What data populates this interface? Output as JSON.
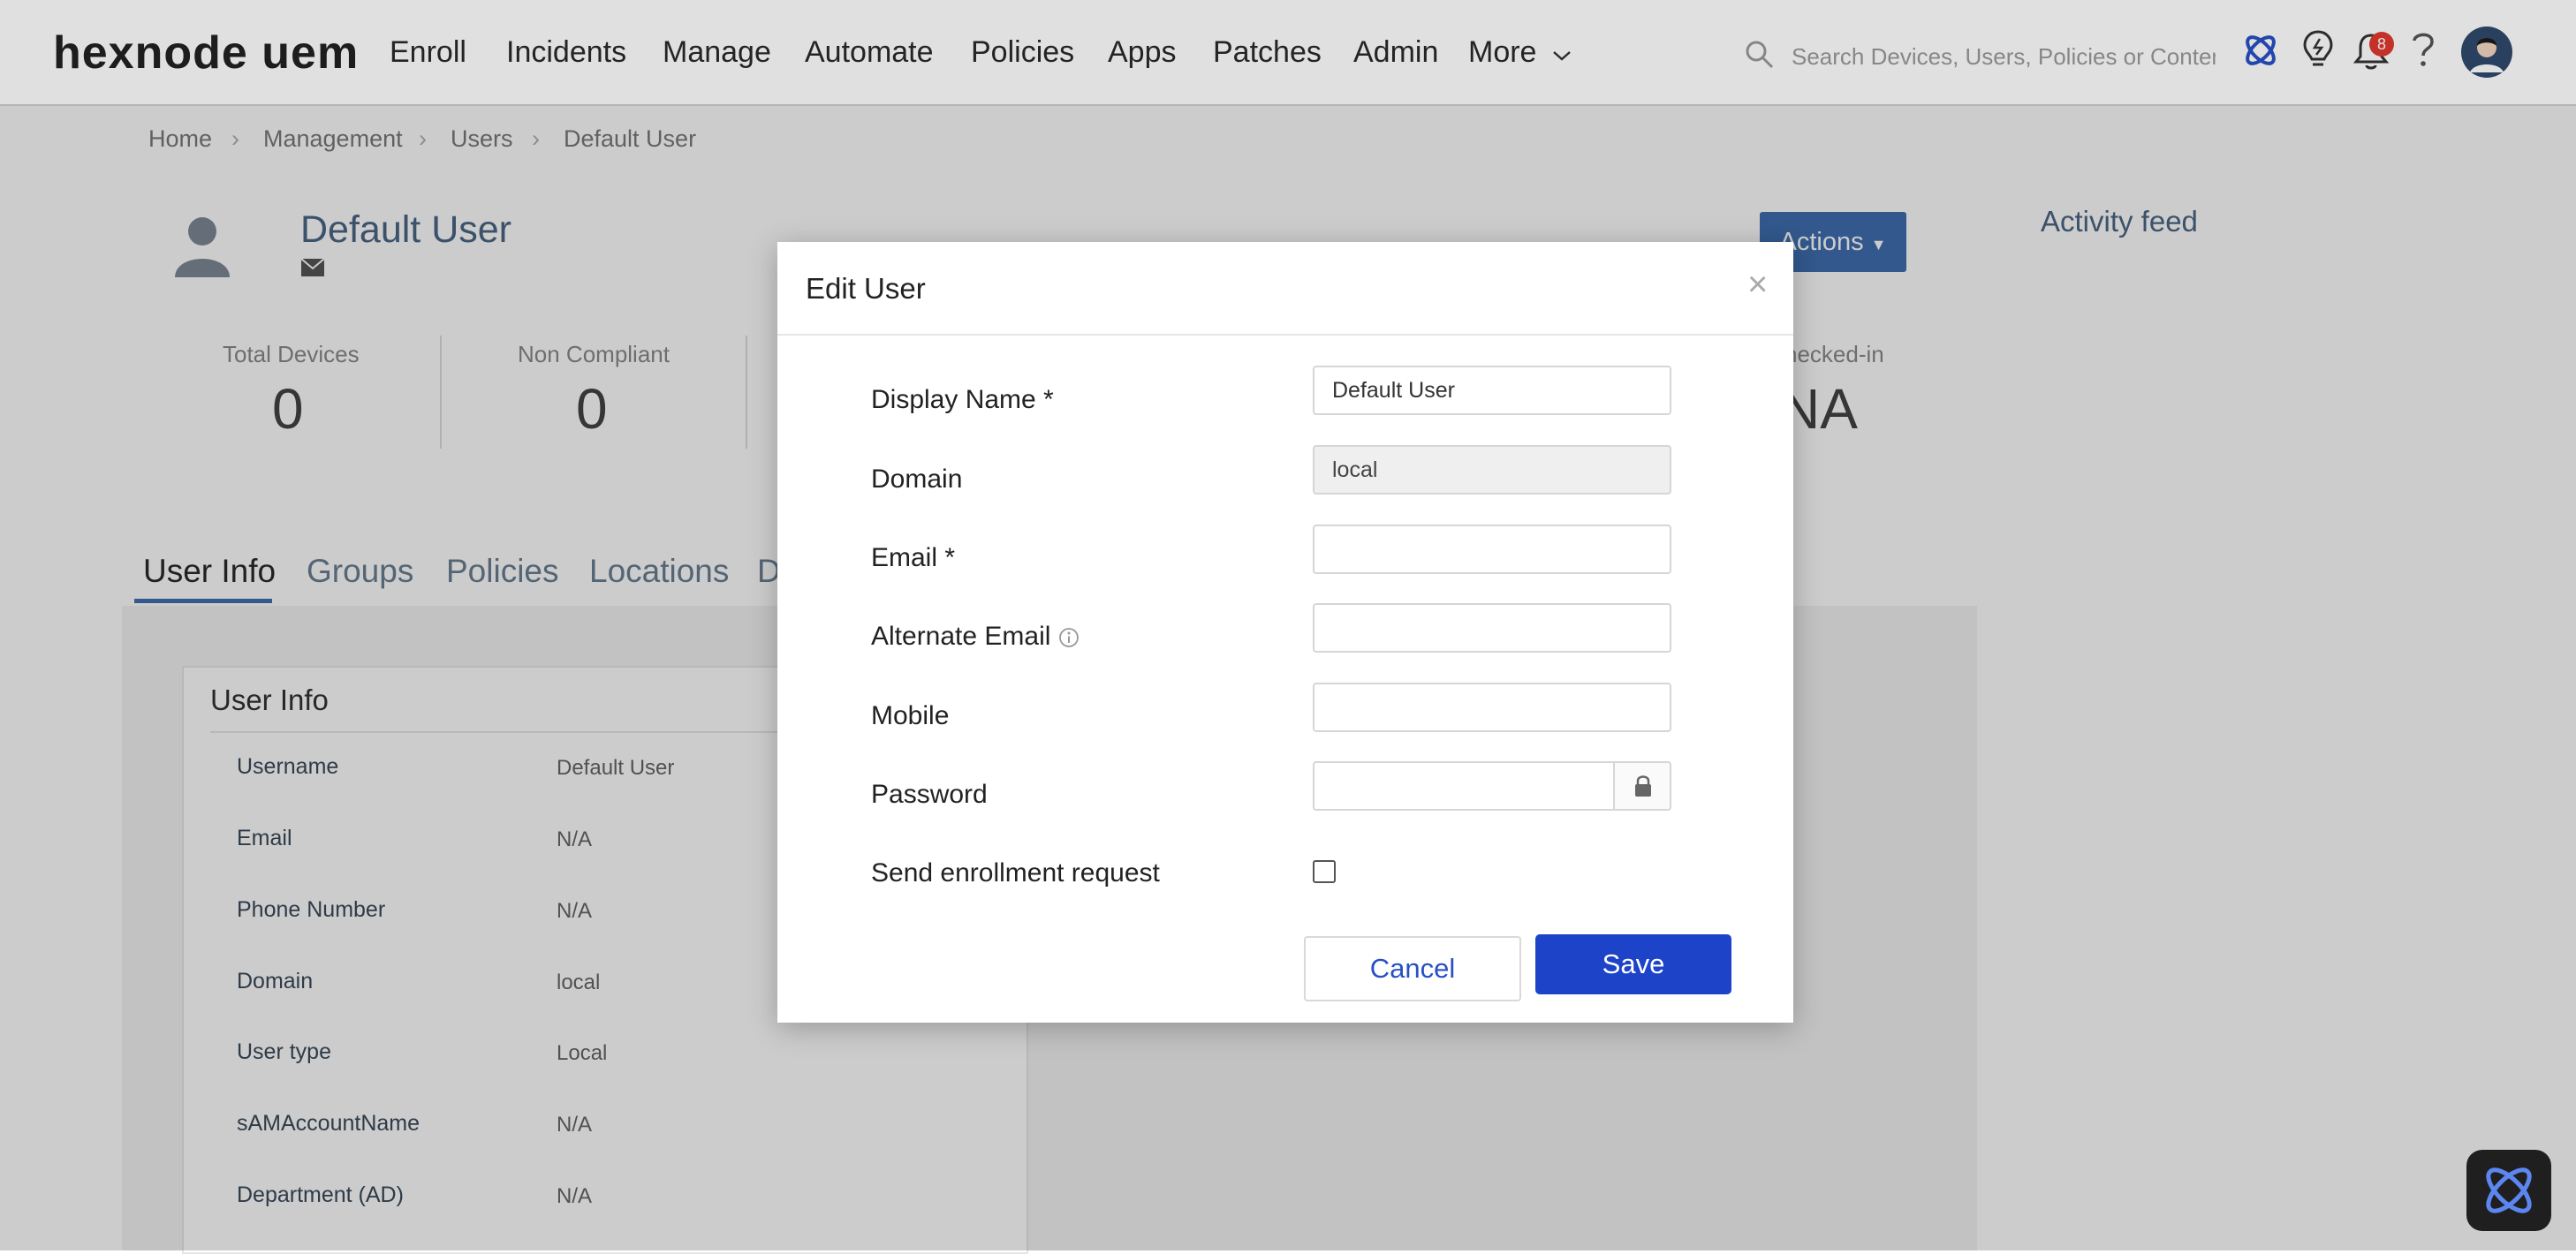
{
  "brand": {
    "logo_text": "hexnode uem"
  },
  "nav": {
    "items": [
      "Enroll",
      "Incidents",
      "Manage",
      "Automate",
      "Policies",
      "Apps",
      "Patches",
      "Admin",
      "More"
    ],
    "search_placeholder": "Search Devices, Users, Policies or Content",
    "notification_count": "8"
  },
  "breadcrumb": [
    "Home",
    "Management",
    "Users",
    "Default User"
  ],
  "user": {
    "name": "Default User",
    "actions_label": "Actions"
  },
  "stats": [
    {
      "label": "Total Devices",
      "value": "0"
    },
    {
      "label": "Non Compliant",
      "value": "0"
    },
    {
      "label": "hecked-in",
      "value": "NA"
    }
  ],
  "tabs": [
    "User Info",
    "Groups",
    "Policies",
    "Locations",
    "D"
  ],
  "user_info": {
    "title": "User Info",
    "rows": [
      {
        "label": "Username",
        "value": "Default User"
      },
      {
        "label": "Email",
        "value": "N/A"
      },
      {
        "label": "Phone Number",
        "value": "N/A"
      },
      {
        "label": "Domain",
        "value": "local"
      },
      {
        "label": "User type",
        "value": "Local"
      },
      {
        "label": "sAMAccountName",
        "value": "N/A"
      },
      {
        "label": "Department (AD)",
        "value": "N/A"
      }
    ]
  },
  "activity_feed": {
    "title": "Activity feed"
  },
  "modal": {
    "title": "Edit User",
    "close_symbol": "×",
    "fields": {
      "display_name": {
        "label": "Display Name *",
        "value": "Default User"
      },
      "domain": {
        "label": "Domain",
        "value": "local"
      },
      "email": {
        "label": "Email *",
        "value": ""
      },
      "alternate_email": {
        "label": "Alternate Email",
        "value": ""
      },
      "mobile": {
        "label": "Mobile",
        "value": ""
      },
      "password": {
        "label": "Password",
        "value": ""
      },
      "send_enrollment": {
        "label": "Send enrollment request",
        "checked": false
      }
    },
    "cancel_label": "Cancel",
    "save_label": "Save"
  },
  "colors": {
    "primary": "#1c43c8",
    "actions": "#3f6fb1",
    "badge": "#e0382f"
  }
}
